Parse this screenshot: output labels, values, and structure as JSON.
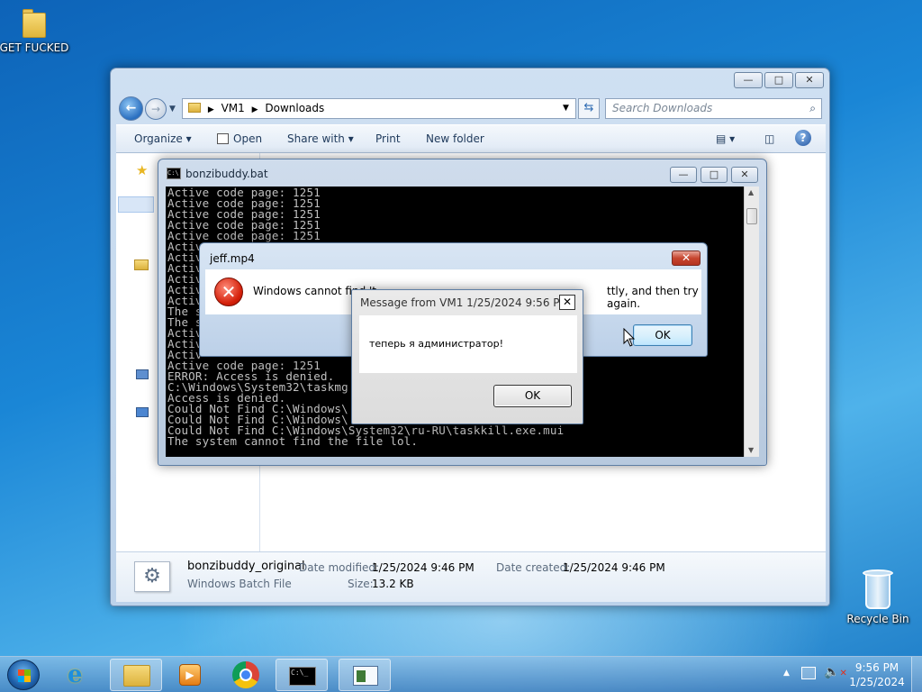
{
  "desktop": {
    "folder_label": "GET FUCKED",
    "recycle_label": "Recycle Bin"
  },
  "explorer": {
    "path": [
      "VM1",
      "Downloads"
    ],
    "search_placeholder": "Search Downloads",
    "toolbar": {
      "organize": "Organize",
      "open": "Open",
      "share_with": "Share with",
      "print": "Print",
      "new_folder": "New folder"
    },
    "details": {
      "file_name": "bonzibuddy_original",
      "file_type": "Windows Batch File",
      "date_modified_label": "Date modified:",
      "date_modified": "1/25/2024 9:46 PM",
      "size_label": "Size:",
      "size": "13.2 KB",
      "date_created_label": "Date created:",
      "date_created": "1/25/2024 9:46 PM"
    }
  },
  "cmd": {
    "title": "bonzibuddy.bat",
    "lines": [
      "Active code page: 1251",
      "Active code page: 1251",
      "Active code page: 1251",
      "Active code page: 1251",
      "Active code page: 1251",
      "Activ",
      "Activ",
      "Activ",
      "Activ",
      "Activ",
      "Activ",
      "The s",
      "The s",
      "Activ",
      "Activ",
      "Activ",
      "Active code page: 1251",
      "ERROR: Access is denied.",
      "C:\\Windows\\System32\\taskmg",
      "Access is denied.",
      "Could Not Find C:\\Windows\\",
      "Could Not Find C:\\Windows\\",
      "Could Not Find C:\\Windows\\System32\\ru-RU\\taskkill.exe.mui",
      "The system cannot find the file lol."
    ]
  },
  "jeff_dialog": {
    "title": "jeff.mp4",
    "message_start": "Windows cannot find 't",
    "message_end": "ttly, and then try again.",
    "ok": "OK"
  },
  "msg_dialog": {
    "title": "Message from VM1 1/25/2024 9:56 PM",
    "message": "теперь я администратор!",
    "ok": "OK"
  },
  "taskbar": {
    "time": "9:56 PM",
    "date": "1/25/2024"
  }
}
